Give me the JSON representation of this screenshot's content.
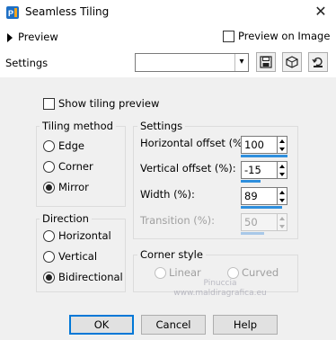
{
  "window": {
    "title": "Seamless Tiling",
    "close_icon": "close-icon"
  },
  "preview": {
    "label": "Preview",
    "preview_on_image_label": "Preview on Image",
    "preview_on_image_checked": false
  },
  "settings_row": {
    "label": "Settings",
    "preset_value": ""
  },
  "show_tiling_preview": {
    "label": "Show tiling preview",
    "checked": false
  },
  "tiling_method": {
    "title": "Tiling method",
    "options": [
      {
        "label": "Edge",
        "selected": false
      },
      {
        "label": "Corner",
        "selected": false
      },
      {
        "label": "Mirror",
        "selected": true
      }
    ]
  },
  "direction": {
    "title": "Direction",
    "options": [
      {
        "label": "Horizontal",
        "selected": false
      },
      {
        "label": "Vertical",
        "selected": false
      },
      {
        "label": "Bidirectional",
        "selected": true
      }
    ]
  },
  "settings_group": {
    "title": "Settings",
    "fields": [
      {
        "label": "Horizontal offset (%):",
        "value": "100",
        "level": 1.0,
        "enabled": true
      },
      {
        "label": "Vertical offset (%):",
        "value": "-15",
        "level": 0.43,
        "enabled": true
      },
      {
        "label": "Width (%):",
        "value": "89",
        "level": 0.89,
        "enabled": true
      },
      {
        "label": "Transition (%):",
        "value": "50",
        "level": 0.5,
        "enabled": false
      }
    ]
  },
  "corner_style": {
    "title": "Corner style",
    "options": [
      {
        "label": "Linear",
        "selected": true,
        "enabled": false
      },
      {
        "label": "Curved",
        "selected": false,
        "enabled": false
      }
    ]
  },
  "watermark": {
    "line1": "Pinuccia",
    "line2": "www.maldiragrafica.eu"
  },
  "buttons": {
    "ok": "OK",
    "cancel": "Cancel",
    "help": "Help"
  },
  "colors": {
    "accent": "#2f8fdd",
    "dialog_bg": "#f0f0f0",
    "default_button_border": "#0078d7"
  }
}
